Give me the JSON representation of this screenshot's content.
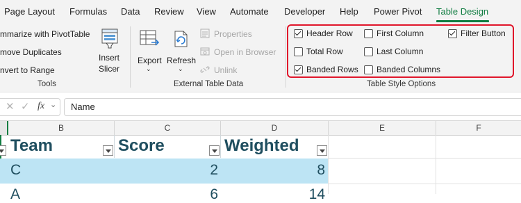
{
  "tabs": [
    "Page Layout",
    "Formulas",
    "Data",
    "Review",
    "View",
    "Automate",
    "Developer",
    "Help",
    "Power Pivot",
    "Table Design"
  ],
  "tools": {
    "summarize": "mmarize with PivotTable",
    "remove_duplicates": "move Duplicates",
    "convert": "nvert to Range",
    "insert_slicer_1": "Insert",
    "insert_slicer_2": "Slicer",
    "group_label": "Tools"
  },
  "external": {
    "export": "Export",
    "refresh": "Refresh",
    "properties": "Properties",
    "open_in_browser": "Open in Browser",
    "unlink": "Unlink",
    "group_label": "External Table Data"
  },
  "style_options": {
    "group_label": "Table Style Options",
    "items": [
      {
        "label": "Header Row",
        "checked": true
      },
      {
        "label": "Total Row",
        "checked": false
      },
      {
        "label": "Banded Rows",
        "checked": true
      },
      {
        "label": "First Column",
        "checked": false
      },
      {
        "label": "Last Column",
        "checked": false
      },
      {
        "label": "Banded Columns",
        "checked": false
      },
      {
        "label": "Filter Button",
        "checked": true
      }
    ]
  },
  "formula_bar": {
    "fx": "fx",
    "value": "Name"
  },
  "columns": [
    "B",
    "C",
    "D",
    "E",
    "F"
  ],
  "table": {
    "headers": [
      "Team",
      "Score",
      "Weighted"
    ],
    "rows": [
      [
        "C",
        "2",
        "8"
      ],
      [
        "A",
        "6",
        "14"
      ]
    ]
  },
  "colors": {
    "accent": "#107c41",
    "highlight": "#e0162b",
    "band": "#bde4f4",
    "header_text": "#1f4e5f"
  }
}
